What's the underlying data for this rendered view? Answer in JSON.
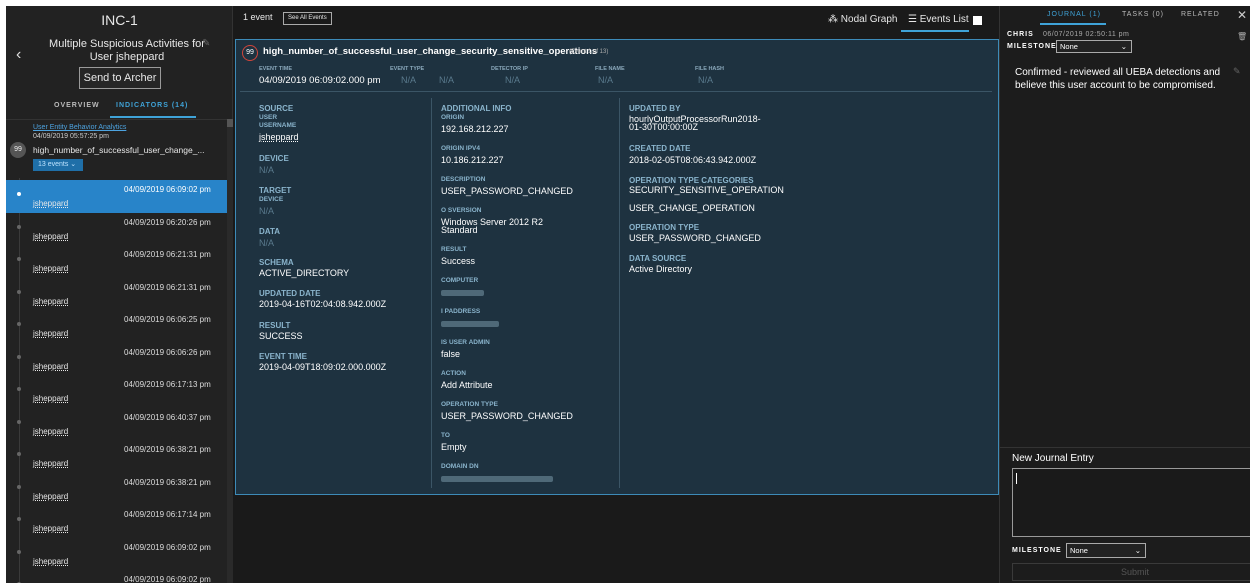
{
  "incident": {
    "id": "INC-1",
    "title": "Multiple Suspicious Activities for User jsheppard",
    "send_label": "Send to Archer"
  },
  "left_tabs": {
    "overview": "OVERVIEW",
    "indicators": "INDICATORS (14)"
  },
  "indicator": {
    "source": "User Entity Behavior Analytics",
    "date": "04/09/2019 05:57:25 pm",
    "score": "99",
    "name": "high_number_of_successful_user_change_...",
    "events_label": "13 events ⌄"
  },
  "events": [
    {
      "time": "04/09/2019 06:09:02 pm",
      "user": "jsheppard",
      "selected": true
    },
    {
      "time": "04/09/2019 06:20:26 pm",
      "user": "jsheppard"
    },
    {
      "time": "04/09/2019 06:21:31 pm",
      "user": "jsheppard"
    },
    {
      "time": "04/09/2019 06:21:31 pm",
      "user": "jsheppard"
    },
    {
      "time": "04/09/2019 06:06:25 pm",
      "user": "jsheppard"
    },
    {
      "time": "04/09/2019 06:06:26 pm",
      "user": "jsheppard"
    },
    {
      "time": "04/09/2019 06:17:13 pm",
      "user": "jsheppard"
    },
    {
      "time": "04/09/2019 06:40:37 pm",
      "user": "jsheppard"
    },
    {
      "time": "04/09/2019 06:38:21 pm",
      "user": "jsheppard"
    },
    {
      "time": "04/09/2019 06:38:21 pm",
      "user": "jsheppard"
    },
    {
      "time": "04/09/2019 06:17:14 pm",
      "user": "jsheppard"
    },
    {
      "time": "04/09/2019 06:09:02 pm",
      "user": "jsheppard"
    },
    {
      "time": "04/09/2019 06:09:02 pm",
      "user": "jsheppard"
    }
  ],
  "toolbar": {
    "count": "1 event",
    "see_all": "See All Events",
    "nodal": "Nodal Graph",
    "events_list": "Events List"
  },
  "card": {
    "score": "99",
    "title": "high_number_of_successful_user_change_security_sensitive_operations",
    "of": "(Event 1 of 13)",
    "header": {
      "event_time_label": "EVENT TIME",
      "event_time": "04/09/2019 06:09:02.000 pm",
      "event_time_na": "N/A",
      "event_type_label": "EVENT TYPE",
      "event_type": "N/A",
      "detector_ip_label": "DETECTOR IP",
      "detector_ip": "N/A",
      "file_name_label": "FILE NAME",
      "file_name": "N/A",
      "file_hash_label": "FILE HASH",
      "file_hash": "N/A"
    },
    "col1": {
      "source": "SOURCE",
      "user": "USER",
      "username_lbl": "USERNAME",
      "username": "jsheppard",
      "device": "DEVICE",
      "device_val": "N/A",
      "target": "TARGET",
      "tdevice": "DEVICE",
      "tdevice_val": "N/A",
      "data": "DATA",
      "data_val": "N/A",
      "schema": "SCHEMA",
      "schema_val": "ACTIVE_DIRECTORY",
      "updated": "UPDATED DATE",
      "updated_val": "2019-04-16T02:04:08.942.000Z",
      "result": "RESULT",
      "result_val": "SUCCESS",
      "etime": "EVENT TIME",
      "etime_val": "2019-04-09T18:09:02.000.000Z"
    },
    "col2": {
      "add": "ADDITIONAL INFO",
      "origin": "ORIGIN",
      "origin_val": "192.168.212.227",
      "ipv4": "ORIGIN IPV4",
      "ipv4_val": "10.186.212.227",
      "desc": "DESCRIPTION",
      "desc_val": "USER_PASSWORD_CHANGED",
      "os": "O SVERSION",
      "os_val1": "Windows Server 2012 R2",
      "os_val2": "Standard",
      "result": "RESULT",
      "result_val": "Success",
      "computer": "COMPUTER",
      "ip": "I PADDRESS",
      "admin": "IS USER ADMIN",
      "admin_val": "false",
      "action": "ACTION",
      "action_val": "Add Attribute",
      "optype": "OPERATION TYPE",
      "optype_val": "USER_PASSWORD_CHANGED",
      "to": "TO",
      "to_val": "Empty",
      "domain": "DOMAIN DN"
    },
    "col3": {
      "updby": "UPDATED BY",
      "updby_val1": "hourlyOutputProcessorRun2018-",
      "updby_val2": "01-30T00:00:00Z",
      "created": "CREATED DATE",
      "created_val": "2018-02-05T08:06:43.942.000Z",
      "opcat": "OPERATION TYPE CATEGORIES",
      "opcat_val1": "SECURITY_SENSITIVE_OPERATION",
      "opcat_val2": "USER_CHANGE_OPERATION",
      "optype": "OPERATION TYPE",
      "optype_val": "USER_PASSWORD_CHANGED",
      "ds": "DATA SOURCE",
      "ds_val": "Active Directory"
    }
  },
  "right": {
    "tabs": {
      "journal": "JOURNAL (1)",
      "tasks": "TASKS (0)",
      "related": "RELATED"
    },
    "close": "✕",
    "author": "CHRIS",
    "date": "06/07/2019 02:50:11 pm",
    "milestone_label": "MILESTONE",
    "milestone": "None",
    "entry": "Confirmed - reviewed all UEBA detections and believe this user account to be compromised.",
    "new_entry": "New Journal Entry",
    "new_milestone": "None",
    "submit": "Submit"
  }
}
